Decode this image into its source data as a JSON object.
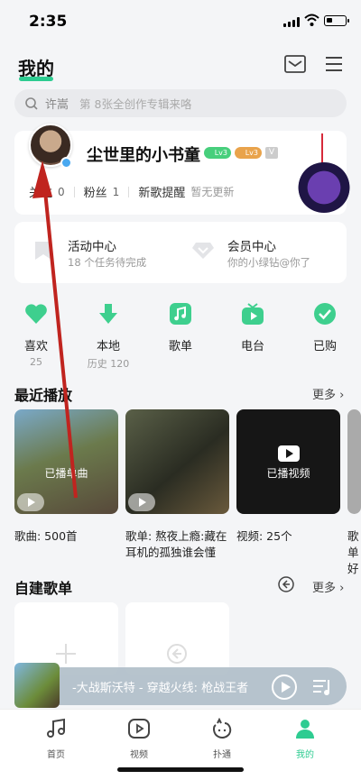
{
  "status": {
    "time": "2:35"
  },
  "header": {
    "title": "我的"
  },
  "search": {
    "query": "许嵩",
    "hint": "第 8张全创作专辑来咯"
  },
  "profile": {
    "username": "尘世里的小书童",
    "badge1": "Lv3",
    "badge2": "Lv3",
    "badge3": "V",
    "follow_label": "关注",
    "follow_count": "0",
    "fans_label": "粉丝",
    "fans_count": "1",
    "newsong_label": "新歌提醒",
    "newsong_status": "暂无更新"
  },
  "activity": {
    "left_title": "活动中心",
    "left_sub": "18 个任务待完成",
    "right_title": "会员中心",
    "right_sub": "你的小绿钻@你了"
  },
  "quick": [
    {
      "label": "喜欢",
      "sub": "25"
    },
    {
      "label": "本地",
      "sub": "历史 120"
    },
    {
      "label": "歌单",
      "sub": ""
    },
    {
      "label": "电台",
      "sub": ""
    },
    {
      "label": "已购",
      "sub": ""
    }
  ],
  "recent": {
    "title": "最近播放",
    "more": "更多 ›",
    "items": [
      {
        "overlay": "已播单曲",
        "caption": "歌曲: 500首"
      },
      {
        "overlay": "",
        "caption": "歌单: 熬夜上瘾:藏在耳机的孤独谁会懂"
      },
      {
        "overlay": "已播视频",
        "caption": "视频: 25个"
      },
      {
        "overlay": "",
        "caption": "歌单好"
      }
    ]
  },
  "playlists": {
    "title": "自建歌单",
    "more": "更多 ›"
  },
  "player": {
    "track": "-大战斯沃特 - 穿越火线: 枪战王者"
  },
  "tabs": [
    {
      "label": "首页"
    },
    {
      "label": "视频"
    },
    {
      "label": "扑通"
    },
    {
      "label": "我的"
    }
  ],
  "colors": {
    "accent": "#2ecc91",
    "arrow": "#c0241f"
  }
}
